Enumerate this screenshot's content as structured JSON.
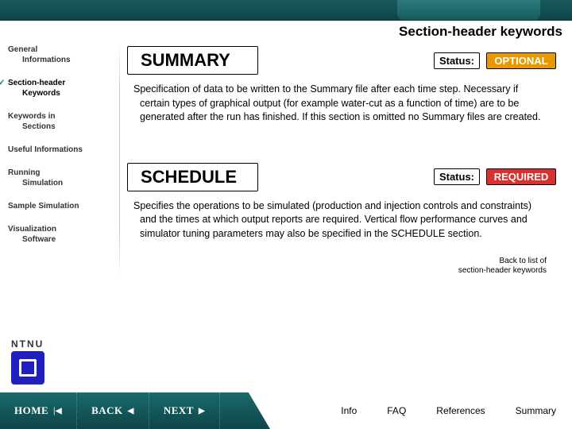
{
  "page_title": "Section-header keywords",
  "sidebar": {
    "items": [
      {
        "line1": "General",
        "line2": "Informations"
      },
      {
        "line1": "Section-header",
        "line2": "Keywords"
      },
      {
        "line1": "Keywords in",
        "line2": "Sections"
      },
      {
        "line1": "Useful Informations",
        "line2": ""
      },
      {
        "line1": "Running",
        "line2": "Simulation"
      },
      {
        "line1": "Sample Simulation",
        "line2": ""
      },
      {
        "line1": "Visualization",
        "line2": "Software"
      }
    ],
    "active_index": 1
  },
  "logo_text": "NTNU",
  "keywords": [
    {
      "name": "SUMMARY",
      "status_label": "Status:",
      "status_value": "OPTIONAL",
      "status_kind": "optional",
      "desc": "Specification of data to be written to the Summary file after each time step. Necessary if certain types of graphical output (for example water-cut as a function of time) are to be generated after the run has finished. If this section is omitted no Summary files are created."
    },
    {
      "name": "SCHEDULE",
      "status_label": "Status:",
      "status_value": "REQUIRED",
      "status_kind": "required",
      "desc": "Specifies the operations to be simulated (production and injection controls and constraints) and the times at which output reports are required. Vertical flow performance curves and simulator tuning parameters may also be specified in the SCHEDULE section."
    }
  ],
  "back_link": {
    "line1": "Back to list of",
    "line2": "section-header keywords"
  },
  "bottom": {
    "home": "HOME",
    "back": "BACK",
    "next": "NEXT",
    "links": [
      "Info",
      "FAQ",
      "References",
      "Summary"
    ]
  }
}
